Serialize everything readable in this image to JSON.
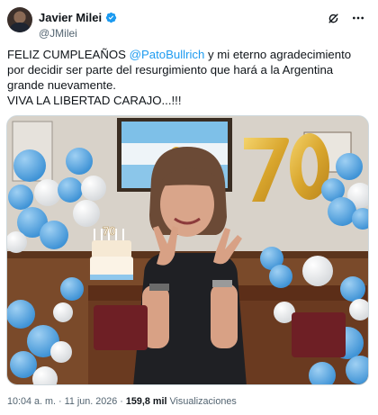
{
  "author": {
    "display_name": "Javier Milei",
    "handle": "@JMilei",
    "verified_icon": "verified-badge-icon",
    "accent": "#1d9bf0"
  },
  "actions": {
    "grok_icon": "grok-icon",
    "more_icon": "more-options-icon"
  },
  "tweet": {
    "text_start": "FELIZ CUMPLEAÑOS ",
    "mention": "@PatoBullrich",
    "text_rest": " y mi eterno agradecimiento por decidir ser parte del resurgimiento que hará a la Argentina grande nuevamente.",
    "line2": "VIVA LA LIBERTAD CARAJO...!!!"
  },
  "media": {
    "balloon_number": "70",
    "cake_topper": "70",
    "balloon_colors": [
      "#5aa7e0",
      "#ffffff"
    ],
    "number_balloon_color": "#e0b43a"
  },
  "meta": {
    "time": "10:04 a. m.",
    "separator1": " · ",
    "date": "11 jun. 2026",
    "separator2": " · ",
    "views_count": "159,8 mil",
    "views_label": " Visualizaciones"
  }
}
